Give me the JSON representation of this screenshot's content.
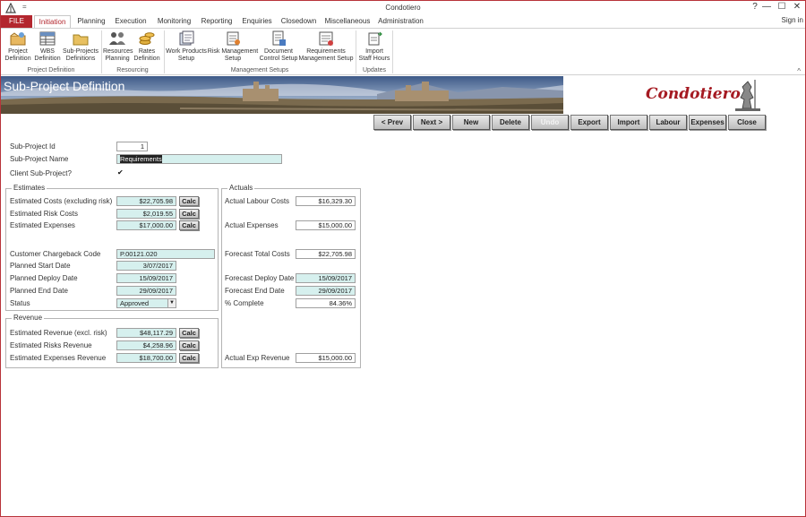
{
  "window": {
    "title": "Condotiero",
    "help": "?",
    "minimize": "—",
    "restore": "☐",
    "close": "✕",
    "sign_in": "Sign in",
    "quick_access": "="
  },
  "ribbon_tabs": [
    "FILE",
    "Initiation",
    "Planning",
    "Execution",
    "Monitoring",
    "Reporting",
    "Enquiries",
    "Closedown",
    "Miscellaneous",
    "Administration"
  ],
  "ribbon": {
    "buttons": [
      {
        "line1": "Project",
        "line2": "Definition"
      },
      {
        "line1": "WBS",
        "line2": "Definition"
      },
      {
        "line1": "Sub-Projects",
        "line2": "Definitions"
      },
      {
        "line1": "Resources",
        "line2": "Planning"
      },
      {
        "line1": "Rates",
        "line2": "Definition"
      },
      {
        "line1": "Work Products",
        "line2": "Setup"
      },
      {
        "line1": "Risk Management",
        "line2": "Setup"
      },
      {
        "line1": "Document",
        "line2": "Control Setup"
      },
      {
        "line1": "Requirements",
        "line2": "Management Setup"
      },
      {
        "line1": "Import",
        "line2": "Staff Hours"
      }
    ],
    "groups": [
      "Project Definition",
      "Resourcing",
      "Management Setups",
      "Updates"
    ],
    "collapse": "^"
  },
  "banner": {
    "title": "Sub-Project Definition",
    "logo": "Condotiero"
  },
  "nav_buttons": [
    "< Prev",
    "Next >",
    "New",
    "Delete",
    "Undo",
    "Export",
    "Import",
    "Labour",
    "Expenses",
    "Close"
  ],
  "form": {
    "sub_project_id_label": "Sub-Project Id",
    "sub_project_id": "1",
    "sub_project_name_label": "Sub-Project Name",
    "sub_project_name": "Requirements",
    "client_sub_project_label": "Client Sub-Project?",
    "client_sub_project_checked": "✔"
  },
  "estimates": {
    "title": "Estimates",
    "est_costs_label": "Estimated Costs (excluding risk)",
    "est_costs": "$22,705.98",
    "est_risk_label": "Estimated Risk Costs",
    "est_risk": "$2,019.55",
    "est_expenses_label": "Estimated Expenses",
    "est_expenses": "$17,000.00",
    "calc": "Calc",
    "chargeback_label": "Customer Chargeback Code",
    "chargeback": "P.00121.020",
    "planned_start_label": "Planned Start Date",
    "planned_start": "3/07/2017",
    "planned_deploy_label": "Planned Deploy Date",
    "planned_deploy": "15/09/2017",
    "planned_end_label": "Planned End Date",
    "planned_end": "29/09/2017",
    "status_label": "Status",
    "status": "Approved"
  },
  "revenue": {
    "title": "Revenue",
    "est_revenue_label": "Estimated Revenue (excl. risk)",
    "est_revenue": "$48,117.29",
    "est_risks_revenue_label": "Estimated Risks Revenue",
    "est_risks_revenue": "$4,258.96",
    "est_expenses_revenue_label": "Estimated Expenses Revenue",
    "est_expenses_revenue": "$18,700.00"
  },
  "actuals": {
    "title": "Actuals",
    "labour_label": "Actual Labour Costs",
    "labour": "$16,329.30",
    "expenses_label": "Actual Expenses",
    "expenses": "$15,000.00",
    "forecast_total_label": "Forecast Total Costs",
    "forecast_total": "$22,705.98",
    "forecast_deploy_label": "Forecast Deploy Date",
    "forecast_deploy": "15/09/2017",
    "forecast_end_label": "Forecast End Date",
    "forecast_end": "29/09/2017",
    "pct_complete_label": "% Complete",
    "pct_complete": "84.36%",
    "exp_revenue_label": "Actual Exp Revenue",
    "exp_revenue": "$15,000.00"
  },
  "colors": {
    "accent": "#b3262e",
    "field_teal": "#d6f0ee"
  }
}
